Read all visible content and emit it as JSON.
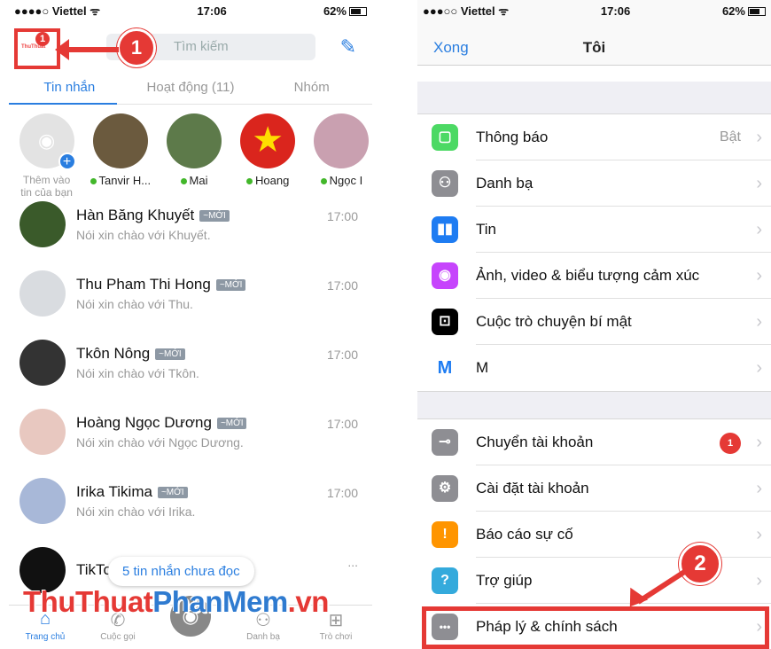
{
  "left": {
    "status": {
      "carrier": "Viettel",
      "time": "17:06",
      "battery": "62%"
    },
    "avatar_badge": "1",
    "search_placeholder": "Tìm kiếm",
    "tabs": [
      "Tin nhắn",
      "Hoạt động (11)",
      "Nhóm"
    ],
    "stories": [
      {
        "label": "Thêm vào tin của bạn",
        "kind": "add"
      },
      {
        "label": "Tanvir H...",
        "color": "#6b5a3e"
      },
      {
        "label": "Mai",
        "color": "#5d7a4a"
      },
      {
        "label": "Hoang",
        "color": "#da251d"
      },
      {
        "label": "Ngọc I",
        "color": "#c9a0b0"
      }
    ],
    "new_badge": "~MỚI",
    "messages": [
      {
        "name": "Hàn Băng Khuyết",
        "snippet": "Nói xin chào với Khuyết.",
        "time": "17:00",
        "color": "#3a5a2a"
      },
      {
        "name": "Thu Pham Thi Hong",
        "snippet": "Nói xin chào với Thu.",
        "time": "17:00",
        "color": "#d9dce0"
      },
      {
        "name": "Tkôn Nông",
        "snippet": "Nói xin chào với Tkôn.",
        "time": "17:00",
        "color": "#333333"
      },
      {
        "name": "Hoàng Ngọc Dương",
        "snippet": "Nói xin chào với Ngọc Dương.",
        "time": "17:00",
        "color": "#e8c8c0"
      },
      {
        "name": "Irika Tikima",
        "snippet": "Nói xin chào với Irika.",
        "time": "17:00",
        "color": "#a8b8d8"
      },
      {
        "name": "TikTok",
        "snippet": "",
        "time": "...",
        "color": "#111111"
      }
    ],
    "unread_pill": "5 tin nhắn chưa đọc",
    "nav": [
      "Trang chủ",
      "Cuộc gọi",
      "",
      "Danh bạ",
      "Trò chơi"
    ],
    "callout": "1",
    "watermark_a": "ThuThuat",
    "watermark_b": "PhanMem",
    "watermark_c": ".vn"
  },
  "right": {
    "status": {
      "carrier": "Viettel",
      "time": "17:06",
      "battery": "62%"
    },
    "done": "Xong",
    "title": "Tôi",
    "section1": [
      {
        "label": "Thông báo",
        "value": "Bật",
        "icon": "notification-icon",
        "color": "#4cd964",
        "glyph": "▢"
      },
      {
        "label": "Danh bạ",
        "icon": "contacts-icon",
        "color": "#8e8e93",
        "glyph": "👥"
      },
      {
        "label": "Tin",
        "icon": "stories-icon",
        "color": "#1e7cf2",
        "glyph": "▮▮"
      },
      {
        "label": "Ảnh, video & biểu tượng cảm xúc",
        "icon": "camera-icon",
        "color": "#c644fc",
        "glyph": "◉"
      },
      {
        "label": "Cuộc trò chuyện bí mật",
        "icon": "lock-icon",
        "color": "#000000",
        "glyph": "🔒"
      },
      {
        "label": "M",
        "icon": "m-assistant-icon",
        "color": "#ffffff",
        "glyph": "M"
      }
    ],
    "section2": [
      {
        "label": "Chuyển tài khoản",
        "badge": "1",
        "icon": "switch-account-icon",
        "color": "#8e8e93",
        "glyph": "⇄"
      },
      {
        "label": "Cài đặt tài khoản",
        "icon": "settings-icon",
        "color": "#8e8e93",
        "glyph": "⚙"
      },
      {
        "label": "Báo cáo sự cố",
        "icon": "report-icon",
        "color": "#ff9500",
        "glyph": "!"
      },
      {
        "label": "Trợ giúp",
        "icon": "help-icon",
        "color": "#34aadc",
        "glyph": "?"
      },
      {
        "label": "Pháp lý & chính sách",
        "icon": "more-icon",
        "color": "#8e8e93",
        "glyph": "•••"
      }
    ],
    "callout": "2"
  }
}
